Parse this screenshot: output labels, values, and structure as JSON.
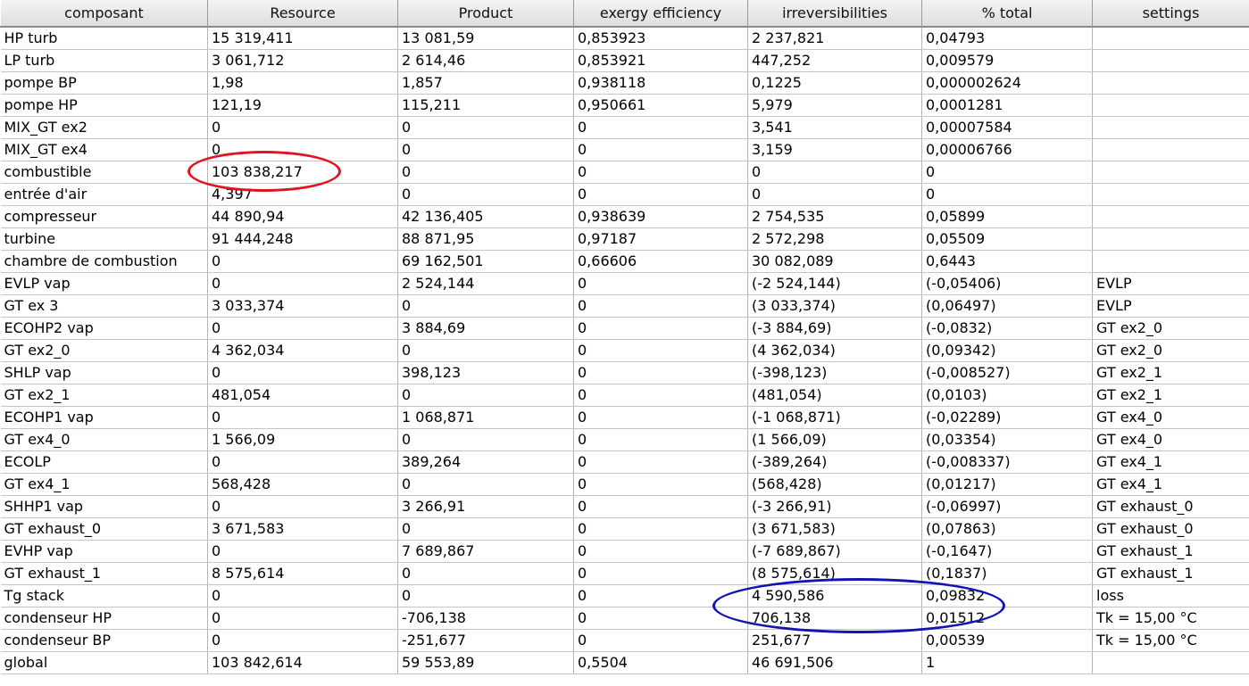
{
  "table": {
    "columns": [
      "composant",
      "Resource",
      "Product",
      "exergy efficiency",
      "irreversibilities",
      "% total",
      "settings"
    ],
    "rows": [
      [
        "HP turb",
        "15 319,411",
        "13 081,59",
        "0,853923",
        "2 237,821",
        "0,04793",
        ""
      ],
      [
        "LP turb",
        "3 061,712",
        "2 614,46",
        "0,853921",
        "447,252",
        "0,009579",
        ""
      ],
      [
        "pompe BP",
        "1,98",
        "1,857",
        "0,938118",
        "0,1225",
        "0,000002624",
        ""
      ],
      [
        "pompe HP",
        "121,19",
        "115,211",
        "0,950661",
        "5,979",
        "0,0001281",
        ""
      ],
      [
        "MIX_GT ex2",
        "0",
        "0",
        "0",
        "3,541",
        "0,00007584",
        ""
      ],
      [
        "MIX_GT ex4",
        "0",
        "0",
        "0",
        "3,159",
        "0,00006766",
        ""
      ],
      [
        "combustible",
        "103 838,217",
        "0",
        "0",
        "0",
        "0",
        ""
      ],
      [
        "entrée d'air",
        "4,397",
        "0",
        "0",
        "0",
        "0",
        ""
      ],
      [
        "compresseur",
        "44 890,94",
        "42 136,405",
        "0,938639",
        "2 754,535",
        "0,05899",
        ""
      ],
      [
        "turbine",
        "91 444,248",
        "88 871,95",
        "0,97187",
        "2 572,298",
        "0,05509",
        ""
      ],
      [
        "chambre de combustion",
        "0",
        "69 162,501",
        "0,66606",
        "30 082,089",
        "0,6443",
        ""
      ],
      [
        "EVLP vap",
        "0",
        "2 524,144",
        "0",
        "(-2 524,144)",
        "(-0,05406)",
        "EVLP"
      ],
      [
        "GT ex 3",
        "3 033,374",
        "0",
        "0",
        "(3 033,374)",
        "(0,06497)",
        "EVLP"
      ],
      [
        "ECOHP2 vap",
        "0",
        "3 884,69",
        "0",
        "(-3 884,69)",
        "(-0,0832)",
        "GT ex2_0"
      ],
      [
        "GT ex2_0",
        "4 362,034",
        "0",
        "0",
        "(4 362,034)",
        "(0,09342)",
        "GT ex2_0"
      ],
      [
        "SHLP vap",
        "0",
        "398,123",
        "0",
        "(-398,123)",
        "(-0,008527)",
        "GT ex2_1"
      ],
      [
        "GT ex2_1",
        "481,054",
        "0",
        "0",
        "(481,054)",
        "(0,0103)",
        "GT ex2_1"
      ],
      [
        "ECOHP1 vap",
        "0",
        "1 068,871",
        "0",
        "(-1 068,871)",
        "(-0,02289)",
        "GT ex4_0"
      ],
      [
        "GT ex4_0",
        "1 566,09",
        "0",
        "0",
        "(1 566,09)",
        "(0,03354)",
        "GT ex4_0"
      ],
      [
        "ECOLP",
        "0",
        "389,264",
        "0",
        "(-389,264)",
        "(-0,008337)",
        "GT ex4_1"
      ],
      [
        "GT ex4_1",
        "568,428",
        "0",
        "0",
        "(568,428)",
        "(0,01217)",
        "GT ex4_1"
      ],
      [
        "SHHP1 vap",
        "0",
        "3 266,91",
        "0",
        "(-3 266,91)",
        "(-0,06997)",
        "GT exhaust_0"
      ],
      [
        "GT exhaust_0",
        "3 671,583",
        "0",
        "0",
        "(3 671,583)",
        "(0,07863)",
        "GT exhaust_0"
      ],
      [
        "EVHP vap",
        "0",
        "7 689,867",
        "0",
        "(-7 689,867)",
        "(-0,1647)",
        "GT exhaust_1"
      ],
      [
        "GT exhaust_1",
        "8 575,614",
        "0",
        "0",
        "(8 575,614)",
        "(0,1837)",
        "GT exhaust_1"
      ],
      [
        "Tg stack",
        "0",
        "0",
        "0",
        "4 590,586",
        "0,09832",
        "loss"
      ],
      [
        "condenseur HP",
        "0",
        "-706,138",
        "0",
        "706,138",
        "0,01512",
        "Tk = 15,00 °C"
      ],
      [
        "condenseur BP",
        "0",
        "-251,677",
        "0",
        "251,677",
        "0,00539",
        "Tk = 15,00 °C"
      ],
      [
        "global",
        "103 842,614",
        "59 553,89",
        "0,5504",
        "46 691,506",
        "1",
        ""
      ]
    ]
  },
  "annotations": {
    "red_color": "#e0141e",
    "blue_color": "#1414b4"
  }
}
